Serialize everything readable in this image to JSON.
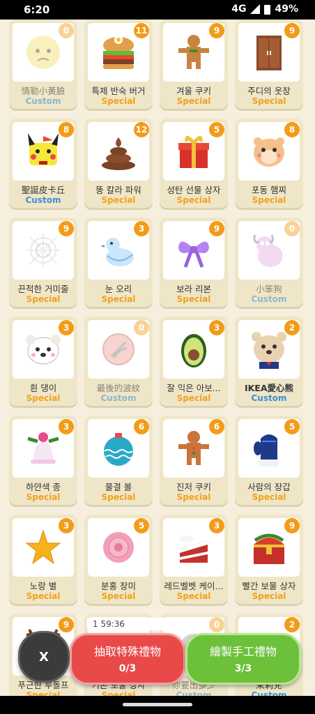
{
  "status": {
    "time": "6:20",
    "signal": "4G",
    "battery": "49%"
  },
  "items": [
    {
      "name": "情勒小黃臉",
      "type": "Custom",
      "count": "0",
      "icon": "sad-face-icon",
      "dim": true
    },
    {
      "name": "특제 반숙 버거",
      "type": "Special",
      "count": "11",
      "icon": "burger-icon"
    },
    {
      "name": "겨울 쿠키",
      "type": "Special",
      "count": "9",
      "icon": "gingerbread-icon"
    },
    {
      "name": "주디의 옷장",
      "type": "Special",
      "count": "9",
      "icon": "wardrobe-icon"
    },
    {
      "name": "聖誕皮卡丘",
      "type": "Custom",
      "count": "8",
      "icon": "pikachu-icon"
    },
    {
      "name": "똥 칼라 파워",
      "type": "Special",
      "count": "12",
      "icon": "poop-icon"
    },
    {
      "name": "성탄 선물 상자",
      "type": "Special",
      "count": "5",
      "icon": "gift-box-icon"
    },
    {
      "name": "포동 햄찌",
      "type": "Special",
      "count": "8",
      "icon": "hamster-icon"
    },
    {
      "name": "끈적한 거미줄",
      "type": "Special",
      "count": "9",
      "icon": "cobweb-icon"
    },
    {
      "name": "눈 오리",
      "type": "Special",
      "count": "3",
      "icon": "snow-duck-icon"
    },
    {
      "name": "보라 리본",
      "type": "Special",
      "count": "9",
      "icon": "purple-ribbon-icon"
    },
    {
      "name": "小笨狗",
      "type": "Custom",
      "count": "0",
      "icon": "dog-icon",
      "dim": true
    },
    {
      "name": "흰 댕이",
      "type": "Special",
      "count": "3",
      "icon": "white-puppy-icon"
    },
    {
      "name": "最後的波紋",
      "type": "Custom",
      "count": "0",
      "icon": "ripple-icon",
      "dim": true
    },
    {
      "name": "잘 익은 아보...",
      "type": "Special",
      "count": "3",
      "icon": "avocado-icon"
    },
    {
      "name": "IKEA愛心熊",
      "type": "Custom",
      "count": "2",
      "icon": "bear-icon",
      "bold": true
    },
    {
      "name": "하얀색 종",
      "type": "Special",
      "count": "3",
      "icon": "bell-icon"
    },
    {
      "name": "물결 볼",
      "type": "Special",
      "count": "6",
      "icon": "ornament-ball-icon"
    },
    {
      "name": "진저 쿠키",
      "type": "Special",
      "count": "6",
      "icon": "ginger-cookie-icon"
    },
    {
      "name": "사람의 장갑",
      "type": "Special",
      "count": "5",
      "icon": "mitten-icon"
    },
    {
      "name": "노랑 별",
      "type": "Special",
      "count": "3",
      "icon": "star-icon"
    },
    {
      "name": "분홍 장미",
      "type": "Special",
      "count": "5",
      "icon": "rose-icon"
    },
    {
      "name": "레드벨벳 케이...",
      "type": "Special",
      "count": "3",
      "icon": "cake-icon"
    },
    {
      "name": "빨간 보물 상자",
      "type": "Special",
      "count": "9",
      "icon": "treasure-chest-icon"
    },
    {
      "name": "푸근한 루돌프",
      "type": "Special",
      "count": "9",
      "icon": "reindeer-icon"
    },
    {
      "name": "기본 보물 상자",
      "type": "Special",
      "count": "",
      "icon": "basic-chest-icon"
    },
    {
      "name": "你要出多少",
      "type": "Custom",
      "count": "0",
      "icon": "unknown-icon",
      "dim": true
    },
    {
      "name": "茉莉兒",
      "type": "Custom",
      "count": "2",
      "icon": "jasmine-icon"
    }
  ],
  "timer_text": "1          59:36",
  "buttons": {
    "close": "X",
    "special_label": "抽取特殊禮物",
    "special_count": "0/3",
    "craft_label": "繪製手工禮物",
    "craft_count": "3/3"
  }
}
